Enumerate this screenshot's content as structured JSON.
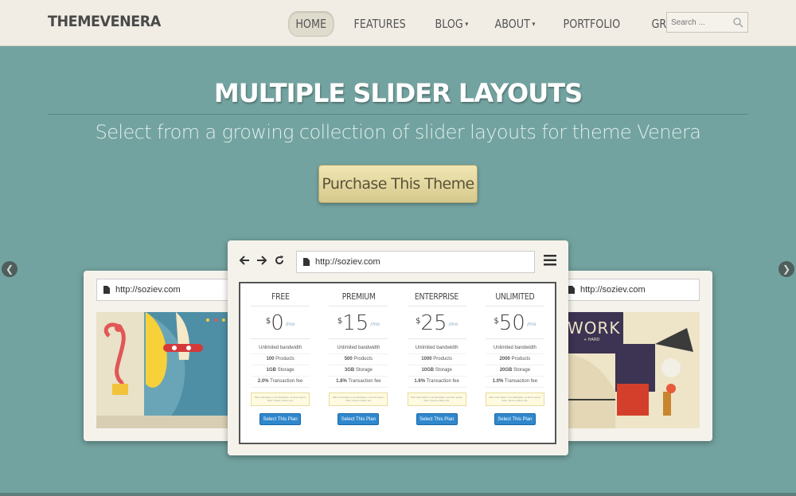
{
  "header": {
    "logo": "THEMEVENERA",
    "nav": [
      {
        "label": "HOME",
        "active": true,
        "dropdown": false
      },
      {
        "label": "FEATURES",
        "active": false,
        "dropdown": false
      },
      {
        "label": "BLOG",
        "active": false,
        "dropdown": true
      },
      {
        "label": "ABOUT",
        "active": false,
        "dropdown": true
      },
      {
        "label": "PORTFOLIO",
        "active": false,
        "dropdown": false
      },
      {
        "label": "GRAVITY FORMS",
        "active": false,
        "dropdown": false
      }
    ],
    "search_placeholder": "Search ..."
  },
  "hero": {
    "title": "MULTIPLE SLIDER LAYOUTS",
    "subtitle": "Select from a growing collection of slider layouts for theme Venera",
    "cta": "Purchase This Theme"
  },
  "slider": {
    "url_left": "http://soziev.com",
    "url_center": "http://soziev.com",
    "url_right": "http://soziev.com",
    "right_art_text": "WORK",
    "right_art_subtext": "+ HARD"
  },
  "pricing": {
    "currency": "$",
    "period": "/mo",
    "button": "Select This Plan",
    "note": "Plan information in an illustration, at lorem ipsum dolor, Fusce a libero est.",
    "plans": [
      {
        "name": "FREE",
        "price": "0",
        "bandwidth": "Unlimited bandwidth",
        "products": "100",
        "products_label": "Products",
        "storage": "1GB",
        "storage_label": "Storage",
        "fee": "2.0%",
        "fee_label": "Transaction fee"
      },
      {
        "name": "PREMIUM",
        "price": "15",
        "bandwidth": "Unlimited bandwidth",
        "products": "500",
        "products_label": "Products",
        "storage": "3GB",
        "storage_label": "Storage",
        "fee": "1.8%",
        "fee_label": "Transaction fee"
      },
      {
        "name": "ENTERPRISE",
        "price": "25",
        "bandwidth": "Unlimited bandwidth",
        "products": "1000",
        "products_label": "Products",
        "storage": "10GB",
        "storage_label": "Storage",
        "fee": "1.6%",
        "fee_label": "Transaction fee"
      },
      {
        "name": "UNLIMITED",
        "price": "50",
        "bandwidth": "Unlimited bandwidth",
        "products": "2000",
        "products_label": "Products",
        "storage": "20GB",
        "storage_label": "Storage",
        "fee": "1.0%",
        "fee_label": "Transaction fee"
      }
    ]
  },
  "colors": {
    "background": "#73a3a0",
    "header": "#f1ede5",
    "cta": "#e6dca2",
    "plan_button": "#2f87cc"
  }
}
